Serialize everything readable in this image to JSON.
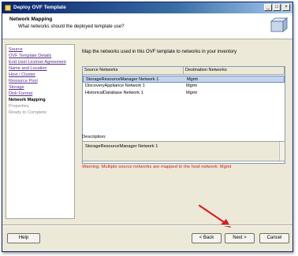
{
  "window": {
    "title": "Deploy OVF Template",
    "controls": {
      "minimize": "_",
      "maximize": "□",
      "close": "×"
    }
  },
  "header": {
    "title": "Network Mapping",
    "subtitle": "What networks should the deployed template use?"
  },
  "nav": {
    "items": [
      {
        "label": "Source",
        "state": "link"
      },
      {
        "label": "OVF Template Details",
        "state": "link"
      },
      {
        "label": "End User License Agreement",
        "state": "link"
      },
      {
        "label": "Name and Location",
        "state": "link"
      },
      {
        "label": "Host / Cluster",
        "state": "link"
      },
      {
        "label": "Resource Pool",
        "state": "link"
      },
      {
        "label": "Storage",
        "state": "link"
      },
      {
        "label": "Disk Format",
        "state": "link"
      },
      {
        "label": "Network Mapping",
        "state": "current"
      },
      {
        "label": "Properties",
        "state": "disabled"
      },
      {
        "label": "Ready to Complete",
        "state": "disabled"
      }
    ]
  },
  "main": {
    "instruction": "Map the networks used in this OVF template to networks in your inventory",
    "table": {
      "columns": [
        "Source Networks",
        "Destination Networks"
      ],
      "rows": [
        {
          "source": "StorageResourceManager Network 1",
          "destination": "Mgmt",
          "selected": true
        },
        {
          "source": "DiscoveryAppliance Network 1",
          "destination": "Mgmt",
          "selected": false
        },
        {
          "source": "HistoricalDatabase Network 1",
          "destination": "Mgmt",
          "selected": false
        }
      ]
    },
    "description_label": "Description:",
    "description_text": "StorageResourceManager Network 1",
    "warning": "Warning: Multiple source networks are mapped to the host network: Mgmt"
  },
  "footer": {
    "help": "Help",
    "back": "< Back",
    "next": "Next >",
    "cancel": "Cancel"
  },
  "colors": {
    "titlebar": "#0a246a",
    "warning": "#d01c1c",
    "arrow": "#d81f26",
    "selection": "#c5d4ec",
    "link": "#5a2d8c"
  },
  "icons": {
    "app": "ovf-template-icon",
    "header": "vm-box-icon",
    "annotation": "red-arrow-icon"
  }
}
